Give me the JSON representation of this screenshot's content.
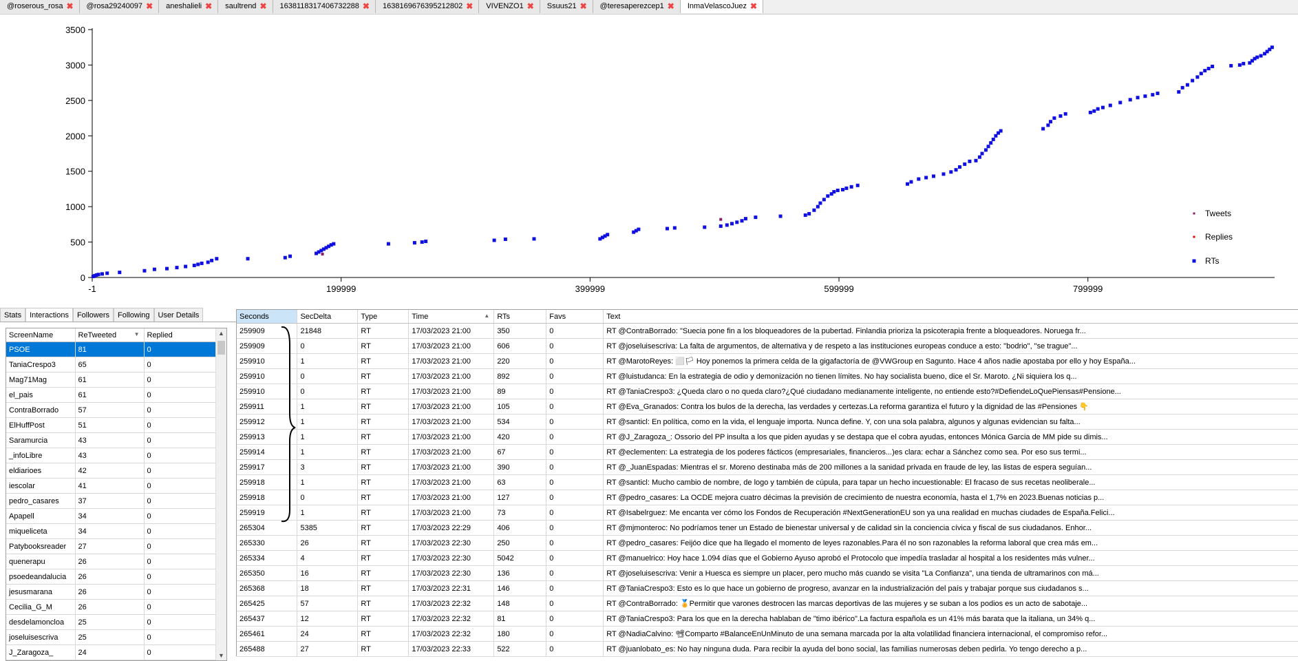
{
  "tabs": [
    {
      "label": "@roserous_rosa"
    },
    {
      "label": "@rosa29240097"
    },
    {
      "label": "aneshalieli"
    },
    {
      "label": "saultrend"
    },
    {
      "label": "1638118317406732288"
    },
    {
      "label": "1638169676395212802"
    },
    {
      "label": "VIVENZO1"
    },
    {
      "label": "Ssuus21"
    },
    {
      "label": "@teresaperezcep1"
    },
    {
      "label": "InmaVelascoJuez",
      "active": true
    }
  ],
  "chart_data": {
    "type": "scatter",
    "x_ticks": [
      "-1",
      "199999",
      "399999",
      "599999",
      "799999"
    ],
    "y_ticks": [
      "0",
      "500",
      "1000",
      "1500",
      "2000",
      "2500",
      "3000",
      "3500"
    ],
    "xlim": [
      -1,
      950000
    ],
    "ylim": [
      0,
      3500
    ],
    "legend_position": "right",
    "colors": {
      "Tweets": "#8b1a6b",
      "Replies": "#e00000",
      "RTs": "#1010e0"
    },
    "series": [
      {
        "name": "Tweets",
        "points": [
          [
            500,
            10
          ],
          [
            2500,
            22
          ],
          [
            185000,
            330
          ],
          [
            505000,
            820
          ]
        ]
      },
      {
        "name": "Replies",
        "points": []
      },
      {
        "name": "RTs",
        "points": [
          [
            800,
            15
          ],
          [
            2000,
            25
          ],
          [
            3500,
            35
          ],
          [
            5000,
            42
          ],
          [
            8000,
            50
          ],
          [
            12000,
            60
          ],
          [
            22000,
            72
          ],
          [
            42000,
            95
          ],
          [
            50000,
            115
          ],
          [
            60000,
            125
          ],
          [
            68000,
            140
          ],
          [
            75000,
            155
          ],
          [
            82000,
            170
          ],
          [
            85000,
            185
          ],
          [
            88000,
            200
          ],
          [
            93000,
            215
          ],
          [
            96000,
            240
          ],
          [
            100000,
            265
          ],
          [
            125000,
            265
          ],
          [
            155000,
            280
          ],
          [
            159000,
            300
          ],
          [
            180000,
            340
          ],
          [
            182000,
            360
          ],
          [
            184000,
            380
          ],
          [
            186000,
            400
          ],
          [
            188000,
            420
          ],
          [
            190000,
            440
          ],
          [
            192000,
            460
          ],
          [
            194000,
            475
          ],
          [
            238000,
            475
          ],
          [
            259000,
            490
          ],
          [
            265000,
            500
          ],
          [
            268000,
            510
          ],
          [
            323000,
            525
          ],
          [
            332000,
            540
          ],
          [
            355000,
            545
          ],
          [
            408000,
            545
          ],
          [
            410000,
            565
          ],
          [
            412000,
            585
          ],
          [
            414000,
            605
          ],
          [
            435000,
            640
          ],
          [
            437000,
            660
          ],
          [
            439000,
            680
          ],
          [
            462000,
            690
          ],
          [
            468000,
            700
          ],
          [
            492000,
            710
          ],
          [
            505000,
            725
          ],
          [
            510000,
            740
          ],
          [
            514000,
            760
          ],
          [
            518000,
            780
          ],
          [
            522000,
            800
          ],
          [
            525000,
            830
          ],
          [
            533000,
            850
          ],
          [
            553000,
            865
          ],
          [
            573000,
            880
          ],
          [
            576000,
            900
          ],
          [
            580000,
            950
          ],
          [
            583000,
            1000
          ],
          [
            585000,
            1050
          ],
          [
            588000,
            1100
          ],
          [
            591000,
            1150
          ],
          [
            594000,
            1180
          ],
          [
            596000,
            1210
          ],
          [
            599000,
            1230
          ],
          [
            603000,
            1240
          ],
          [
            606000,
            1260
          ],
          [
            610000,
            1280
          ],
          [
            615000,
            1300
          ],
          [
            655000,
            1320
          ],
          [
            658000,
            1350
          ],
          [
            664000,
            1390
          ],
          [
            670000,
            1410
          ],
          [
            676000,
            1430
          ],
          [
            684000,
            1460
          ],
          [
            690000,
            1490
          ],
          [
            694000,
            1520
          ],
          [
            697000,
            1560
          ],
          [
            701000,
            1600
          ],
          [
            705000,
            1640
          ],
          [
            710000,
            1650
          ],
          [
            713000,
            1700
          ],
          [
            715000,
            1750
          ],
          [
            718000,
            1800
          ],
          [
            720000,
            1850
          ],
          [
            722000,
            1900
          ],
          [
            724000,
            1950
          ],
          [
            726000,
            2000
          ],
          [
            728000,
            2040
          ],
          [
            730000,
            2070
          ],
          [
            764000,
            2100
          ],
          [
            768000,
            2150
          ],
          [
            770000,
            2200
          ],
          [
            773000,
            2250
          ],
          [
            778000,
            2280
          ],
          [
            782000,
            2310
          ],
          [
            802000,
            2330
          ],
          [
            805000,
            2350
          ],
          [
            808000,
            2380
          ],
          [
            812000,
            2400
          ],
          [
            818000,
            2430
          ],
          [
            826000,
            2470
          ],
          [
            834000,
            2510
          ],
          [
            840000,
            2540
          ],
          [
            846000,
            2560
          ],
          [
            852000,
            2580
          ],
          [
            856000,
            2600
          ],
          [
            873000,
            2620
          ],
          [
            876000,
            2680
          ],
          [
            880000,
            2720
          ],
          [
            884000,
            2780
          ],
          [
            888000,
            2830
          ],
          [
            891000,
            2880
          ],
          [
            894000,
            2920
          ],
          [
            897000,
            2950
          ],
          [
            900000,
            2980
          ],
          [
            915000,
            2990
          ],
          [
            922000,
            3000
          ],
          [
            925000,
            3020
          ],
          [
            930000,
            3030
          ],
          [
            932000,
            3060
          ],
          [
            934000,
            3090
          ],
          [
            936000,
            3110
          ],
          [
            939000,
            3130
          ],
          [
            942000,
            3160
          ],
          [
            944000,
            3190
          ],
          [
            946000,
            3220
          ],
          [
            948000,
            3250
          ]
        ]
      }
    ]
  },
  "left_panel": {
    "tabs": [
      "Stats",
      "Interactions",
      "Followers",
      "Following",
      "User Details"
    ],
    "active_tab": "Interactions",
    "columns": [
      "ScreenName",
      "ReTweeted",
      "Replied"
    ],
    "rows": [
      [
        "PSOE",
        "81",
        "0"
      ],
      [
        "TaniaCrespo3",
        "65",
        "0"
      ],
      [
        "Mag71Mag",
        "61",
        "0"
      ],
      [
        "el_pais",
        "61",
        "0"
      ],
      [
        "ContraBorrado",
        "57",
        "0"
      ],
      [
        "ElHuffPost",
        "51",
        "0"
      ],
      [
        "Saramurcia",
        "43",
        "0"
      ],
      [
        "_infoLibre",
        "43",
        "0"
      ],
      [
        "eldiarioes",
        "42",
        "0"
      ],
      [
        "iescolar",
        "41",
        "0"
      ],
      [
        "pedro_casares",
        "37",
        "0"
      ],
      [
        "Apapell",
        "34",
        "0"
      ],
      [
        "miqueliceta",
        "34",
        "0"
      ],
      [
        "Patybooksreader",
        "27",
        "0"
      ],
      [
        "quenerapu",
        "26",
        "0"
      ],
      [
        "psoedeandalucia",
        "26",
        "0"
      ],
      [
        "jesusmarana",
        "26",
        "0"
      ],
      [
        "Cecilia_G_M",
        "26",
        "0"
      ],
      [
        "desdelamoncloa",
        "25",
        "0"
      ],
      [
        "joseluisescriva",
        "25",
        "0"
      ],
      [
        "J_Zaragoza_",
        "24",
        "0"
      ]
    ]
  },
  "right_panel": {
    "columns": [
      "Seconds",
      "SecDelta",
      "Type",
      "Time",
      "RTs",
      "Favs",
      "Text"
    ],
    "rows": [
      [
        "259909",
        "21848",
        "RT",
        "17/03/2023 21:00",
        "350",
        "0",
        "RT @ContraBorrado: \"Suecia pone fin a los bloqueadores de la pubertad. Finlandia prioriza la psicoterapia frente a bloqueadores. Noruega fr..."
      ],
      [
        "259909",
        "0",
        "RT",
        "17/03/2023 21:00",
        "606",
        "0",
        "RT @joseluisescriva: La falta de argumentos, de alternativa y de respeto a las instituciones europeas conduce a esto: \"bodrio\", \"se trague\"..."
      ],
      [
        "259910",
        "1",
        "RT",
        "17/03/2023 21:00",
        "220",
        "0",
        "RT @MarotoReyes: ⬜🏳 Hoy ponemos la primera celda de la gigafactoría de @VWGroup en Sagunto. Hace 4 años nadie apostaba por ello y hoy España..."
      ],
      [
        "259910",
        "0",
        "RT",
        "17/03/2023 21:00",
        "892",
        "0",
        "RT @luistudanca: En la estrategia de odio y demonización no tienen límites. No hay socialista bueno, dice el Sr. Maroto. ¿Ni siquiera los q..."
      ],
      [
        "259910",
        "0",
        "RT",
        "17/03/2023 21:00",
        "89",
        "0",
        "RT @TaniaCrespo3: ¿Queda claro o no queda claro?¿Qué ciudadano medianamente inteligente, no entiende esto?#DefiendeLoQuePiensas#Pensione..."
      ],
      [
        "259911",
        "1",
        "RT",
        "17/03/2023 21:00",
        "105",
        "0",
        "RT @Eva_Granados: Contra los bulos de la derecha, las verdades y certezas.La reforma garantiza el futuro y la dignidad de las #Pensiones 👇"
      ],
      [
        "259912",
        "1",
        "RT",
        "17/03/2023 21:00",
        "534",
        "0",
        "RT @santicl: En política, como en la vida, el lenguaje importa. Nunca define. Y, con una sola palabra, algunos y algunas evidencian su falta..."
      ],
      [
        "259913",
        "1",
        "RT",
        "17/03/2023 21:00",
        "420",
        "0",
        "RT @J_Zaragoza_: Ossorio del PP insulta a los que piden ayudas y se destapa que el cobra ayudas, entonces Mónica Garcia de MM pide su dimis..."
      ],
      [
        "259914",
        "1",
        "RT",
        "17/03/2023 21:00",
        "67",
        "0",
        "RT @eclementen: La estrategia de los poderes fácticos (empresariales, financieros...)es clara:  echar a Sánchez como sea. Por eso sus termi..."
      ],
      [
        "259917",
        "3",
        "RT",
        "17/03/2023 21:00",
        "390",
        "0",
        "RT @_JuanEspadas: Mientras el sr. Moreno destinaba más de 200 millones a la sanidad privada en fraude de ley, las listas de espera seguían..."
      ],
      [
        "259918",
        "1",
        "RT",
        "17/03/2023 21:00",
        "63",
        "0",
        "RT @santicl: Mucho cambio de nombre, de logo y también de cúpula, para tapar un hecho incuestionable: El fracaso de sus recetas neoliberale..."
      ],
      [
        "259918",
        "0",
        "RT",
        "17/03/2023 21:00",
        "127",
        "0",
        "RT @pedro_casares: La OCDE mejora cuatro décimas la previsión de crecimiento de nuestra economía, hasta el 1,7% en 2023.Buenas noticias p..."
      ],
      [
        "259919",
        "1",
        "RT",
        "17/03/2023 21:00",
        "73",
        "0",
        "RT @Isabelrguez: Me encanta ver cómo los Fondos de Recuperación #NextGenerationEU son ya una realidad en muchas ciudades de España.Felici..."
      ],
      [
        "265304",
        "5385",
        "RT",
        "17/03/2023 22:29",
        "406",
        "0",
        "RT @mjmonteroc: No podríamos tener un Estado de bienestar universal y de calidad sin la conciencia cívica y fiscal de sus ciudadanos. Enhor..."
      ],
      [
        "265330",
        "26",
        "RT",
        "17/03/2023 22:30",
        "250",
        "0",
        "RT @pedro_casares: Feijóo dice que ha llegado el momento de leyes razonables.Para él no son razonables la reforma laboral que crea más em..."
      ],
      [
        "265334",
        "4",
        "RT",
        "17/03/2023 22:30",
        "5042",
        "0",
        "RT @manuelrico: Hoy hace 1.094 días que el Gobierno Ayuso aprobó el Protocolo que impedía trasladar al hospital a los residentes más vulner..."
      ],
      [
        "265350",
        "16",
        "RT",
        "17/03/2023 22:30",
        "136",
        "0",
        "RT @joseluisescriva: Venir a Huesca es siempre un placer, pero mucho más cuando se visita \"La Confianza\", una tienda de ultramarinos con má..."
      ],
      [
        "265368",
        "18",
        "RT",
        "17/03/2023 22:31",
        "146",
        "0",
        "RT @TaniaCrespo3: Esto es lo que hace un gobierno de progreso, avanzar en la industrialización del país  y trabajar porque sus ciudadanos s..."
      ],
      [
        "265425",
        "57",
        "RT",
        "17/03/2023 22:32",
        "148",
        "0",
        "RT @ContraBorrado: 🏅Permitir que varones destrocen las marcas deportivas de las mujeres y se suban a los podios es un acto de sabotaje..."
      ],
      [
        "265437",
        "12",
        "RT",
        "17/03/2023 22:32",
        "81",
        "0",
        "RT @TaniaCrespo3: Para los que en la derecha hablaban de \"timo ibérico\".La factura española es un 41% más barata que la italiana, un 34% q..."
      ],
      [
        "265461",
        "24",
        "RT",
        "17/03/2023 22:32",
        "180",
        "0",
        "RT @NadiaCalvino: 📽Comparto #BalanceEnUnMinuto de una semana marcada por la alta volatilidad financiera internacional, el compromiso refor..."
      ],
      [
        "265488",
        "27",
        "RT",
        "17/03/2023 22:33",
        "522",
        "0",
        "RT @juanlobato_es: No hay ninguna duda. Para recibir la ayuda del bono social, las familias numerosas deben pedirla. Yo tengo derecho a p..."
      ]
    ]
  }
}
